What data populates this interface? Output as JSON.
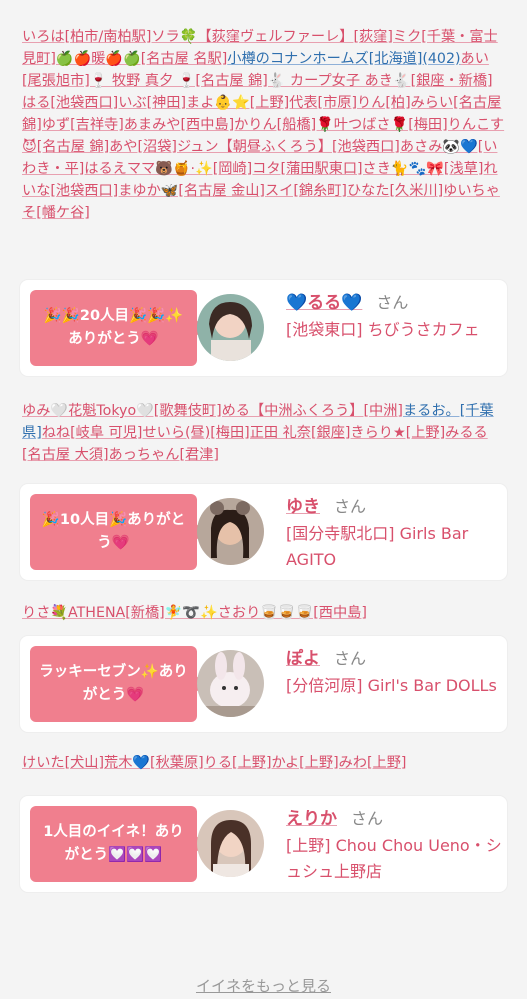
{
  "feed": {
    "group1": "いろは[柏市/南柏駅]ソラ🍀【荻窪ヴェルファーレ】[荻窪]ミク[千葉・富士見町]🍏🍎暖🍎🍏[名古屋 名駅]",
    "group1_blue": "小樽のコナンホームズ[北海道](402)",
    "group1_rest": "あい[尾張旭市]🍷 牧野 真夕 🍷[名古屋 錦]🐇 カープ女子 あき🐇[銀座・新橋]はる[池袋西口]いぶ[神田]まよ👶⭐[上野]代表[市原]りん[柏]みらい[名古屋 錦]ゆず[吉祥寺]あまみや[西中島]かりん[船橋]🌹叶つばさ🌹[梅田]りんこす😈[名古屋 錦]あや[沼袋]ジュン【朝昼ふくろう】[池袋西口]あさみ🐼💙[いわき・平]はるえママ🐻🍯·✨[岡崎]コタ[蒲田駅東口]さき🐈🐾🎀[浅草]れいな[池袋西口]まゆか🦋[名古屋 金山]スイ[錦糸町]ひなた[久米川]ゆいちゃそ[幡ケ谷]",
    "group2": "ゆみ🤍花魁Tokyo🤍[歌舞伎町]める【中洲ふくろう】[中洲]",
    "group2_blue": "まるお。[千葉県]",
    "group2_rest": "ねね[岐阜 可児]せいら(昼)[梅田]正田 礼奈[銀座]きらり★[上野]みるる[名古屋 大須]あっちゃん[君津]",
    "group3": "りさ💐ATHENA[新橋]🧚➰✨さおり🥃🥃🥃[西中島]",
    "group4": "けいた[犬山]荒木💙[秋葉原]りる[上野]かよ[上野]みわ[上野]"
  },
  "cards": [
    {
      "bubble": "🎉🎉20人目🎉🎉✨ありがとう💗",
      "name": "💙るる💙",
      "san": "さん",
      "shop": "[池袋東口] ちびうさカフェ"
    },
    {
      "bubble": "🎉10人目🎉ありがとう💗",
      "name": "ゆき",
      "san": "さん",
      "shop": "[国分寺駅北口] Girls Bar AGITO"
    },
    {
      "bubble": "ラッキーセブン✨ありがとう💗",
      "name": "ぽよ",
      "san": "さん",
      "shop": "[分倍河原] Girl's Bar DOLLs"
    },
    {
      "bubble": "1人目のイイネ！ありがとう💟💟💟",
      "name": "えりか",
      "san": "さん",
      "shop": "[上野] Chou Chou Ueno・シュシュ上野店"
    }
  ],
  "more_link": "イイネをもっと見る"
}
